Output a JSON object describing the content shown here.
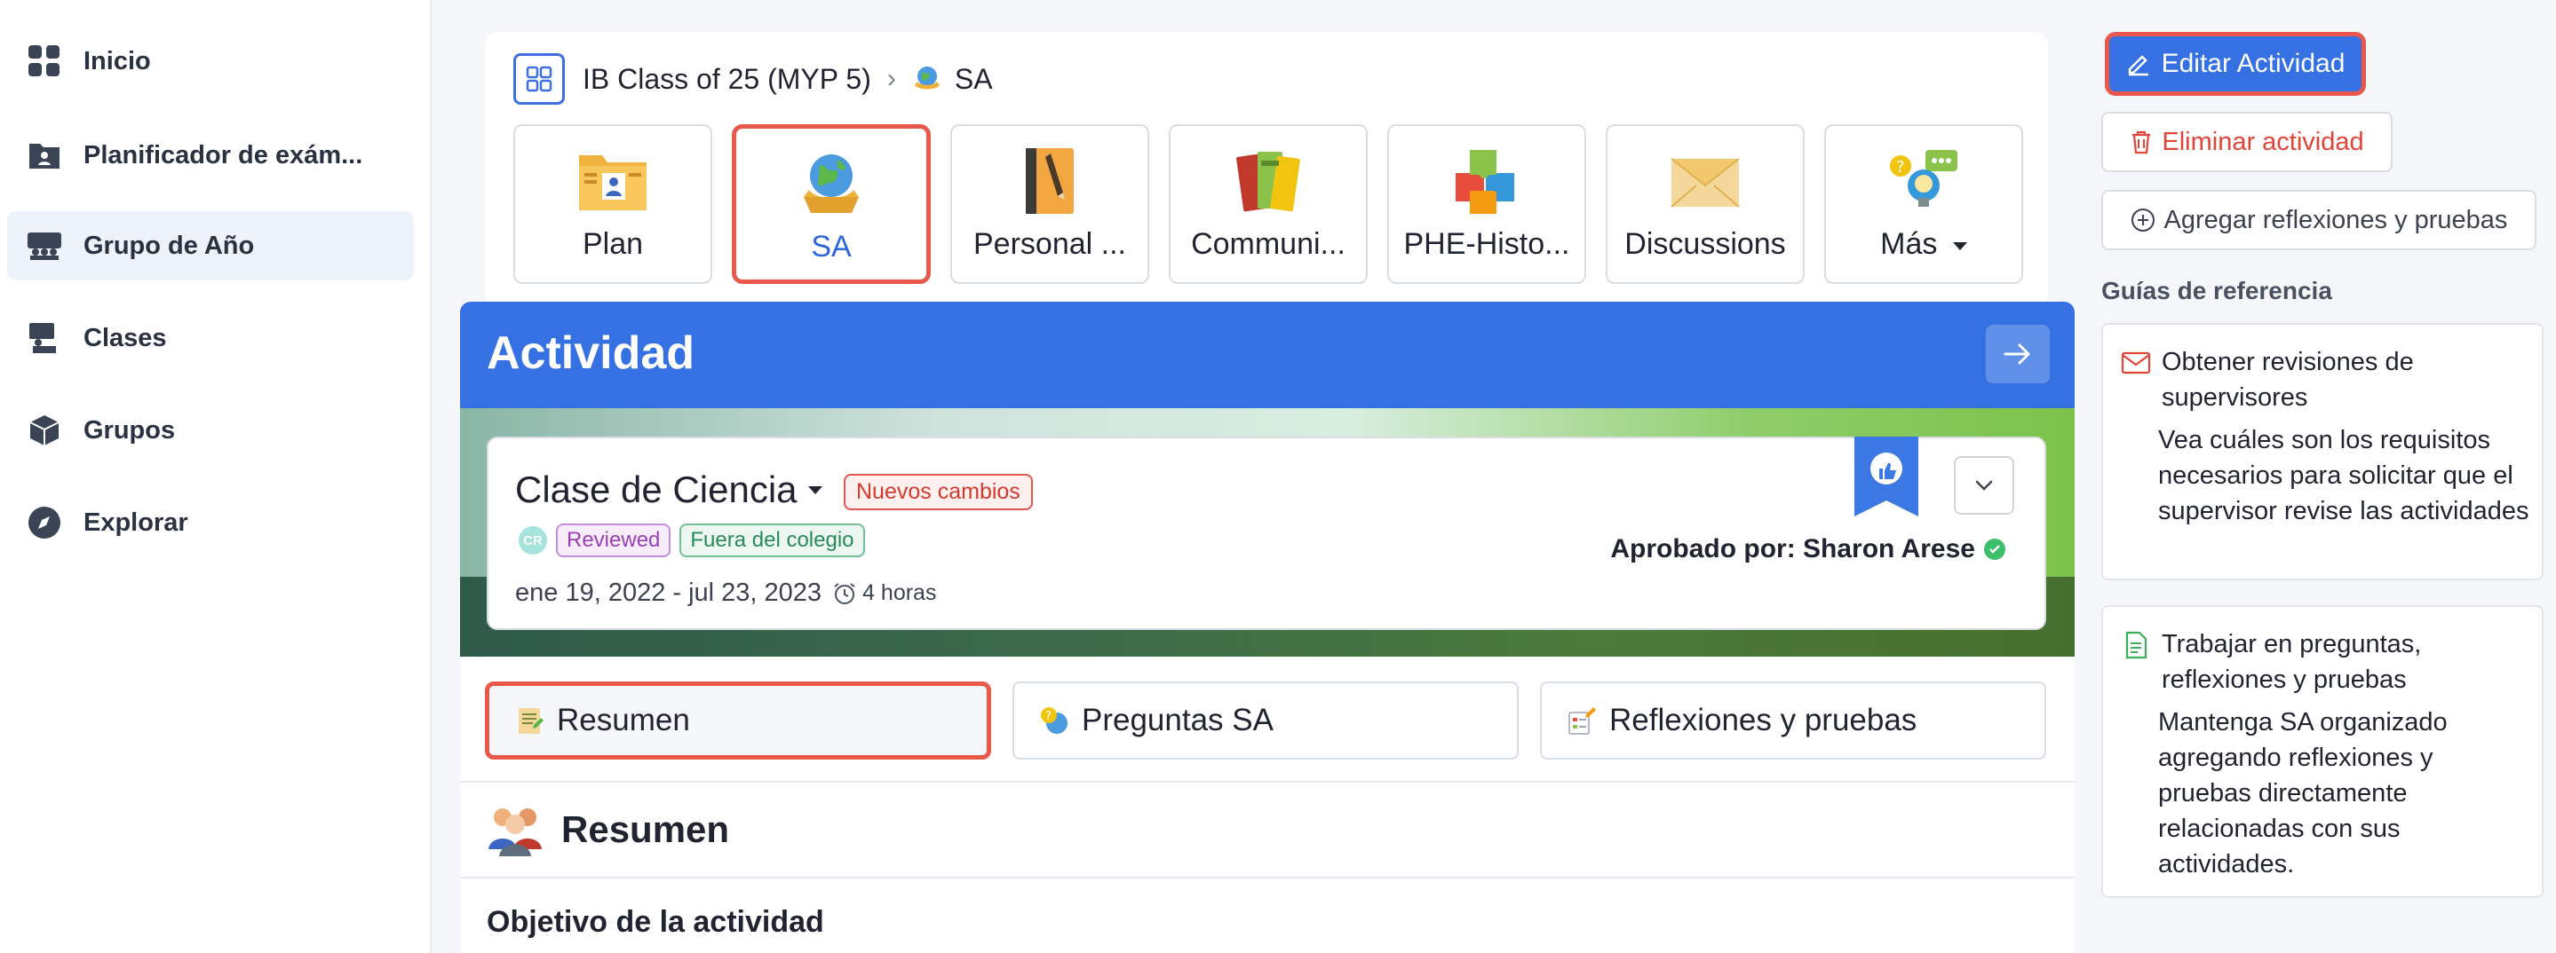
{
  "sidebar": {
    "items": [
      {
        "label": "Inicio",
        "icon": "grid-icon"
      },
      {
        "label": "Planificador de exám...",
        "icon": "folder-user-icon"
      },
      {
        "label": "Grupo de Año",
        "icon": "group-icon"
      },
      {
        "label": "Clases",
        "icon": "lectern-icon"
      },
      {
        "label": "Grupos",
        "icon": "cube-icon"
      },
      {
        "label": "Explorar",
        "icon": "compass-icon"
      }
    ]
  },
  "breadcrumb": {
    "class": "IB Class of 25 (MYP 5)",
    "current": "SA"
  },
  "tabs": [
    {
      "label": "Plan"
    },
    {
      "label": "SA"
    },
    {
      "label": "Personal ..."
    },
    {
      "label": "Communi..."
    },
    {
      "label": "PHE-Histo..."
    },
    {
      "label": "Discussions"
    },
    {
      "label": "Más"
    }
  ],
  "activity": {
    "header": "Actividad",
    "title": "Clase de Ciencia",
    "changes_badge": "Nuevos cambios",
    "avatar": "CR",
    "tag_reviewed": "Reviewed",
    "tag_location": "Fuera del colegio",
    "dates": "ene 19, 2022 - jul 23, 2023",
    "hours": "4 horas",
    "approved": "Aprobado por: Sharon Arese"
  },
  "subtabs": [
    {
      "label": "Resumen"
    },
    {
      "label": "Preguntas SA"
    },
    {
      "label": "Reflexiones y pruebas"
    }
  ],
  "summary": {
    "title": "Resumen",
    "objective": "Objetivo de la actividad"
  },
  "actions": {
    "edit": "Editar Actividad",
    "delete": "Eliminar actividad",
    "add": "Agregar reflexiones y pruebas"
  },
  "guides": {
    "title": "Guías de referencia",
    "items": [
      {
        "heading_1": "Obtener revisiones de",
        "heading_2": "supervisores",
        "body": "Vea cuáles son los requisitos necesarios para solicitar que el supervisor revise las actividades"
      },
      {
        "heading_1": "Trabajar en preguntas,",
        "heading_2": "reflexiones y pruebas",
        "body": "Mantenga SA organizado agregando reflexiones y pruebas directamente relacionadas con sus actividades."
      }
    ]
  },
  "colors": {
    "accent": "#3571e3",
    "highlight": "#e8594a",
    "danger": "#e1453a"
  }
}
